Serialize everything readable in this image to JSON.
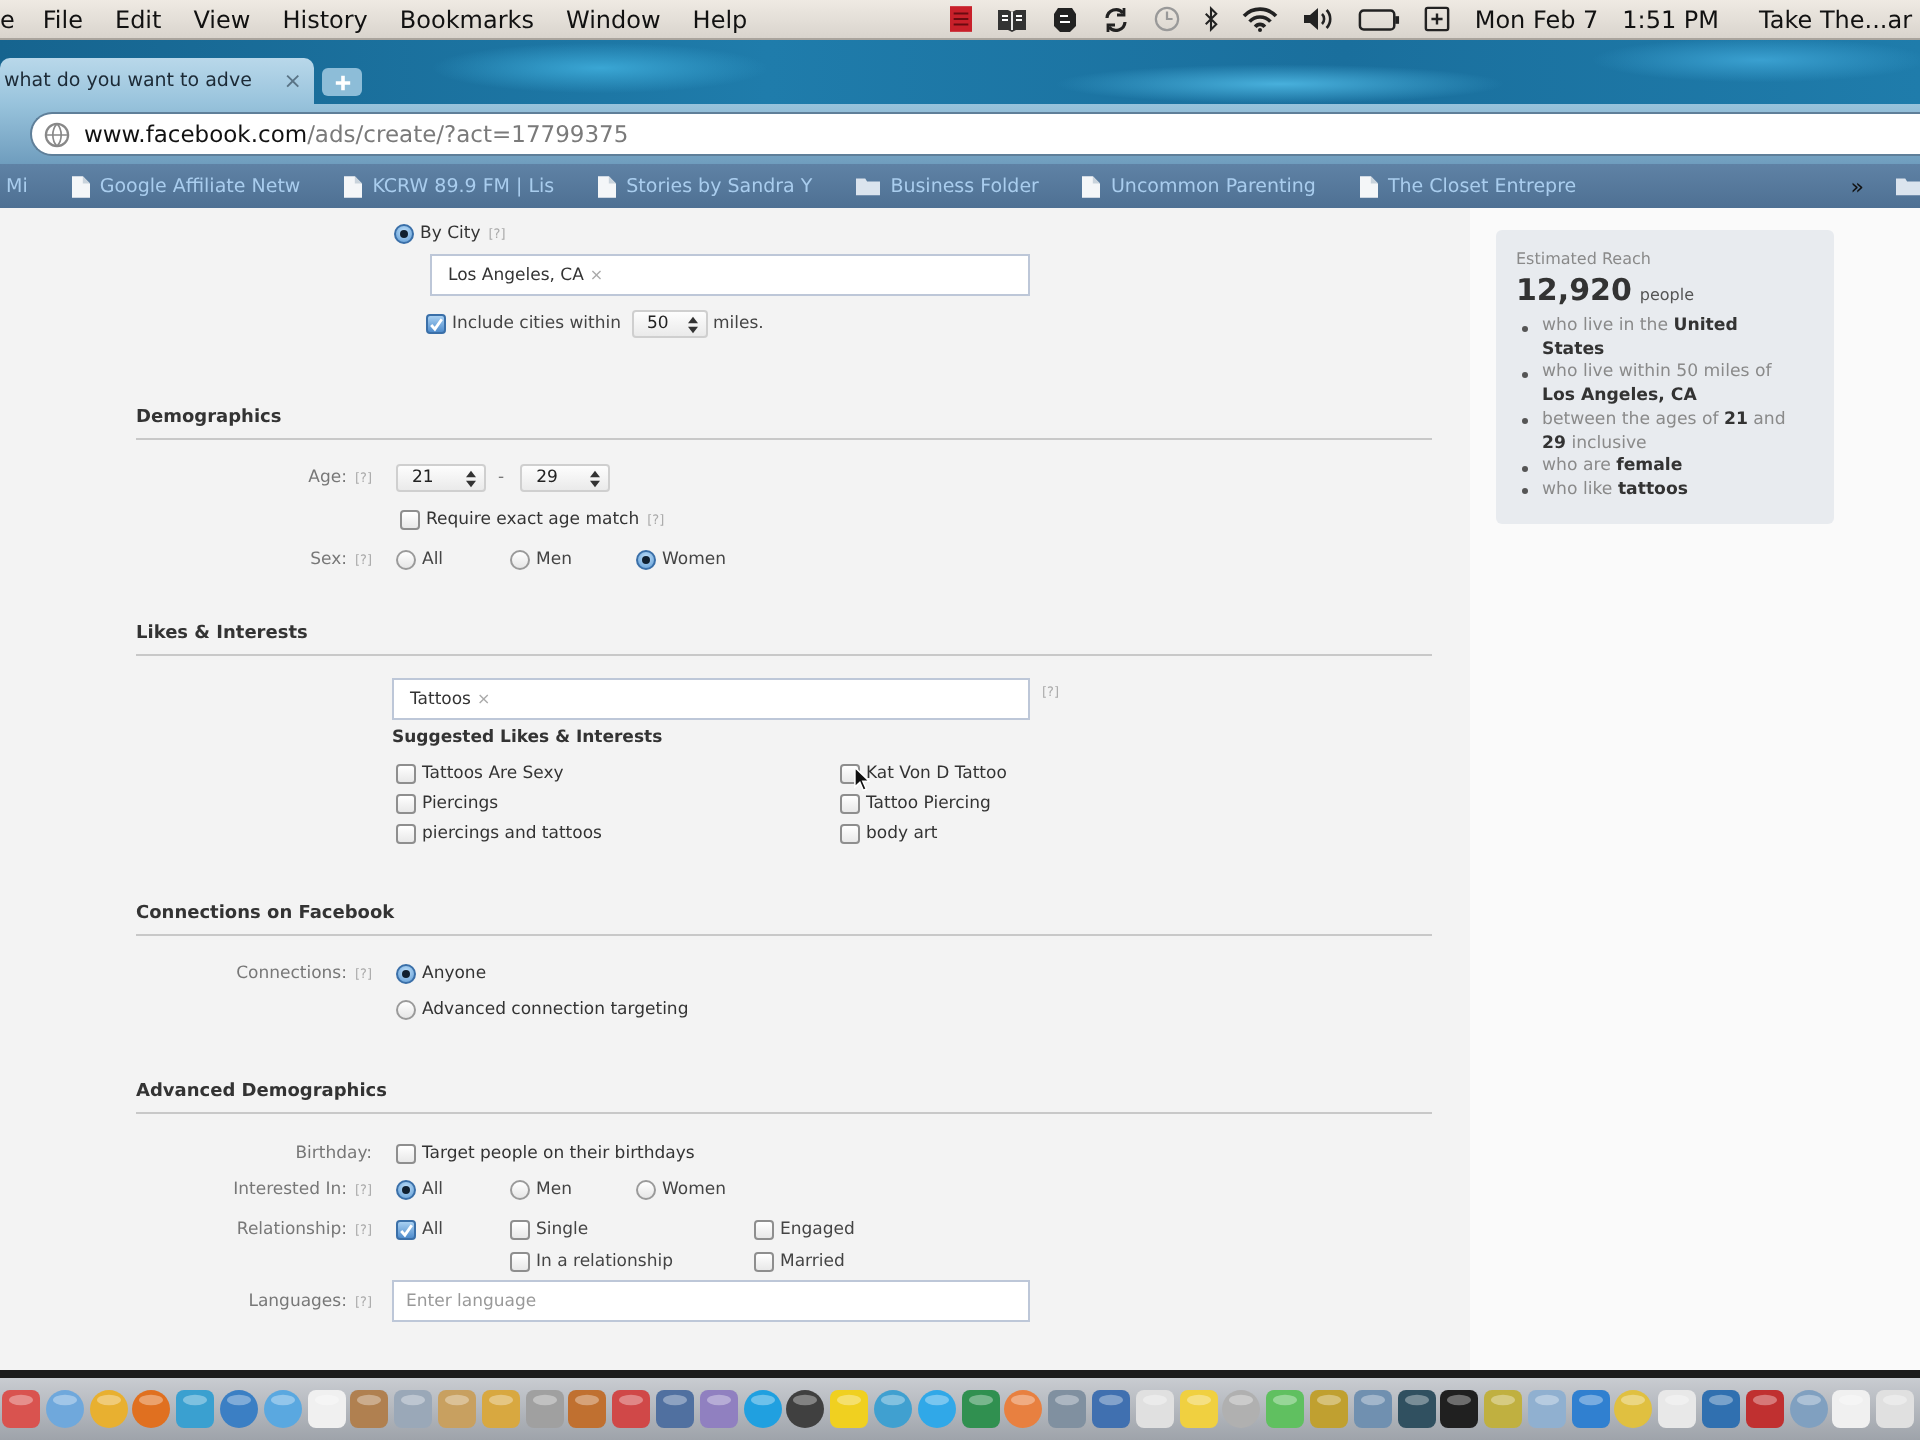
{
  "menu_bar": {
    "app_name": "e",
    "menus": [
      "File",
      "Edit",
      "View",
      "History",
      "Bookmarks",
      "Window",
      "Help"
    ],
    "date": "Mon Feb 7",
    "time": "1:51 PM",
    "user": "Take The...ar"
  },
  "tabs": [
    {
      "title": "what do you want to adve",
      "close": "×",
      "selected": true
    }
  ],
  "address_bar": {
    "domain": "www.facebook.com",
    "path": "/ads/create/?act=17799375"
  },
  "bookmarks": {
    "items": [
      {
        "label": "Mi",
        "kind": "plain"
      },
      {
        "label": "Google Affiliate Netw",
        "kind": "page"
      },
      {
        "label": "KCRW 89.9 FM | Lis",
        "kind": "page"
      },
      {
        "label": "Stories by Sandra Y",
        "kind": "page"
      },
      {
        "label": "Business Folder",
        "kind": "folder"
      },
      {
        "label": "Uncommon Parenting",
        "kind": "page"
      },
      {
        "label": "The Closet Entrepre",
        "kind": "page"
      }
    ],
    "overflow": "»"
  },
  "location": {
    "by_city": {
      "label": "By City",
      "help": "[?]",
      "selected": true
    },
    "cities": [
      {
        "label": "Los Angeles, CA",
        "remove": "×"
      }
    ],
    "radius": {
      "label": "Include cities within",
      "value": "50",
      "unit": "miles.",
      "checked": true
    }
  },
  "demographics": {
    "title": "Demographics",
    "age": {
      "label": "Age:",
      "help": "[?]",
      "from": "21",
      "separator": "-",
      "to": "29"
    },
    "exact_age": {
      "label": "Require exact age match",
      "help": "[?]",
      "checked": false
    },
    "sex": {
      "label": "Sex:",
      "help": "[?]",
      "options": [
        {
          "label": "All",
          "selected": false
        },
        {
          "label": "Men",
          "selected": false
        },
        {
          "label": "Women",
          "selected": true
        }
      ]
    }
  },
  "likes_interests": {
    "title": "Likes & Interests",
    "tags": [
      {
        "label": "Tattoos",
        "remove": "×"
      }
    ],
    "help": "[?]",
    "suggested_title": "Suggested Likes & Interests",
    "suggestions": [
      {
        "label": "Tattoos Are Sexy",
        "checked": false
      },
      {
        "label": "Piercings",
        "checked": false
      },
      {
        "label": "piercings and tattoos",
        "checked": false
      },
      {
        "label": "Kat Von D Tattoo",
        "checked": false
      },
      {
        "label": "Tattoo Piercing",
        "checked": false
      },
      {
        "label": "body art",
        "checked": false
      }
    ]
  },
  "connections": {
    "title": "Connections on Facebook",
    "label": "Connections:",
    "help": "[?]",
    "options": [
      {
        "label": "Anyone",
        "selected": true
      },
      {
        "label": "Advanced connection targeting",
        "selected": false
      }
    ]
  },
  "advanced_demographics": {
    "title": "Advanced Demographics",
    "birthday": {
      "label": "Birthday:",
      "option": "Target people on their birthdays",
      "checked": false
    },
    "interested_in": {
      "label": "Interested In:",
      "help": "[?]",
      "options": [
        {
          "label": "All",
          "selected": true
        },
        {
          "label": "Men",
          "selected": false
        },
        {
          "label": "Women",
          "selected": false
        }
      ]
    },
    "relationship": {
      "label": "Relationship:",
      "help": "[?]",
      "options": [
        {
          "label": "All",
          "checked": true
        },
        {
          "label": "Single",
          "checked": false
        },
        {
          "label": "Engaged",
          "checked": false
        },
        {
          "label": "In a relationship",
          "checked": false
        },
        {
          "label": "Married",
          "checked": false
        }
      ]
    },
    "languages": {
      "label": "Languages:",
      "help": "[?]",
      "placeholder": "Enter language"
    }
  },
  "estimated_reach": {
    "title": "Estimated Reach",
    "count": "12,920",
    "unit": "people",
    "criteria": [
      "who live in the **United States**",
      "who live within 50 miles of **Los Angeles, CA**",
      "between the ages of **21** and **29** inclusive",
      "who are **female**",
      "who like **tattoos**"
    ]
  }
}
